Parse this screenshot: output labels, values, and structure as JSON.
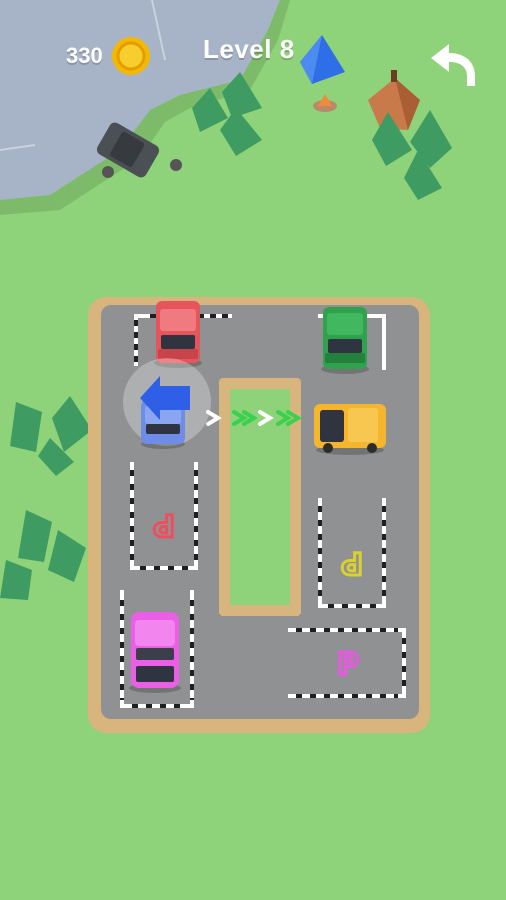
{
  "hud": {
    "coins": "330",
    "level": "Level 8",
    "coin_icon": "gold-coin-icon",
    "undo_icon": "undo-arrow-icon"
  },
  "parking_slots": [
    {
      "id": "left-middle",
      "label": "P",
      "color": "#ee4f5c"
    },
    {
      "id": "right-middle",
      "label": "P",
      "color": "#d9d031"
    },
    {
      "id": "right-bottom",
      "label": "P",
      "color": "#ee55e6"
    }
  ],
  "cars": [
    {
      "id": "red-car",
      "color": "#e6555b"
    },
    {
      "id": "green-car",
      "color": "#2ea24c"
    },
    {
      "id": "blue-car",
      "color": "#6f8de6",
      "selected": true
    },
    {
      "id": "yellow-car",
      "color": "#f5b52c"
    },
    {
      "id": "pink-car",
      "color": "#ea5fe6"
    }
  ],
  "colors": {
    "grass": "#8ed27a",
    "asphalt": "#8f9192",
    "border": "#d7b57c",
    "water": "#a6b3c8",
    "tree": "#3e9b61",
    "path_arrow": "#3bd04f",
    "selection_arrow": "#2f5fe6"
  }
}
